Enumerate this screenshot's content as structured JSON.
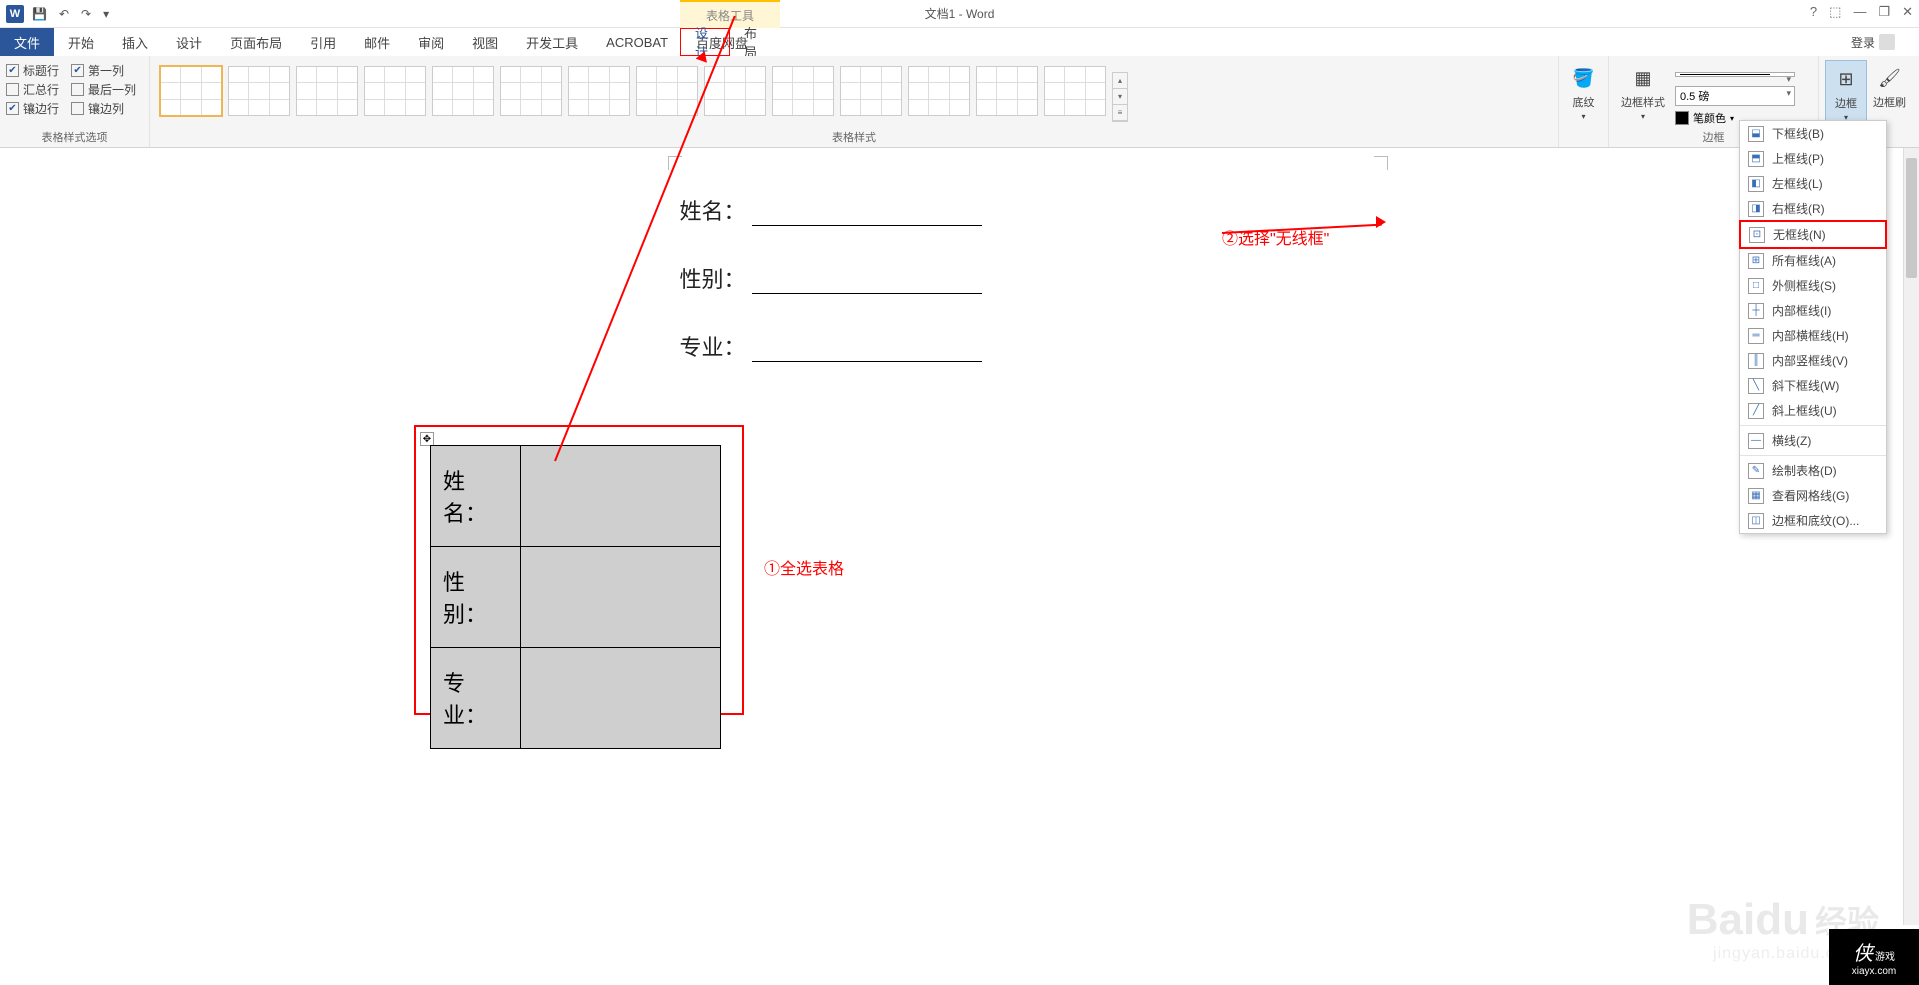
{
  "titlebar": {
    "doc_title": "文档1 - Word",
    "context_title": "表格工具"
  },
  "win": {
    "help": "?",
    "ribbon_toggle": "⬚",
    "min": "—",
    "restore": "❐",
    "close": "✕"
  },
  "tabs": {
    "file": "文件",
    "home": "开始",
    "insert": "插入",
    "design": "设计",
    "layout": "页面布局",
    "references": "引用",
    "mail": "邮件",
    "review": "审阅",
    "view": "视图",
    "dev": "开发工具",
    "acrobat": "ACROBAT",
    "baidu": "百度网盘",
    "table_design": "设计",
    "table_layout": "布局",
    "login": "登录"
  },
  "style_options": {
    "header_row": "标题行",
    "first_col": "第一列",
    "total_row": "汇总行",
    "last_col": "最后一列",
    "banded_row": "镶边行",
    "banded_col": "镶边列",
    "group_label": "表格样式选项"
  },
  "styles_group": "表格样式",
  "shading": "底纹",
  "border_styles": "边框样式",
  "border_weight": "0.5 磅",
  "pen_color": "笔颜色",
  "borders_btn": "边框",
  "border_painter": "边框刷",
  "borders_group": "边框",
  "dropdown": {
    "bottom": "下框线(B)",
    "top": "上框线(P)",
    "left": "左框线(L)",
    "right": "右框线(R)",
    "none": "无框线(N)",
    "all": "所有框线(A)",
    "outside": "外侧框线(S)",
    "inside": "内部框线(I)",
    "inside_h": "内部横框线(H)",
    "inside_v": "内部竖框线(V)",
    "diag_down": "斜下框线(W)",
    "diag_up": "斜上框线(U)",
    "hline": "横线(Z)",
    "draw": "绘制表格(D)",
    "gridlines": "查看网格线(G)",
    "dialog": "边框和底纹(O)..."
  },
  "doc": {
    "name": "姓名：",
    "gender": "性别：",
    "major": "专业："
  },
  "annotations": {
    "step1": "①全选表格",
    "step2": "②选择\"无线框\""
  },
  "watermark": {
    "brand": "Baidu",
    "suffix": "经验",
    "url": "jingyan.baidu.com"
  },
  "corner": {
    "main": "侠",
    "sub": "游戏",
    "url": "xiayx.com"
  }
}
